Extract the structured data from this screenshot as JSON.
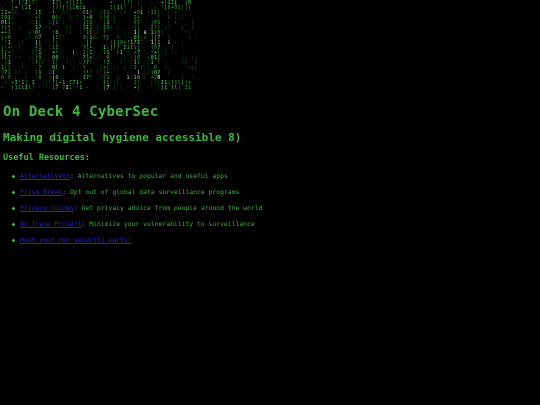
{
  "page": {
    "background_color": "#000000",
    "text_color": "#3fae3f",
    "link_color": "#1f27d6"
  },
  "banner": {
    "logo_text": "ODAC",
    "style": "matrix-rain"
  },
  "site_title": "On Deck 4 CyberSec",
  "tagline": "Making digital hygiene accessible 8)",
  "resources": {
    "heading": "Useful Resources:",
    "items": [
      {
        "link": "Alternativeto",
        "separator": ": ",
        "description": "Alternatives to popular and useful apps"
      },
      {
        "link": "Prism Break",
        "separator": ": ",
        "description": "Opt out of global data surveillance programs"
      },
      {
        "link": "Privacy Guides",
        "separator": ": ",
        "description": "Get privacy advice from people around the world"
      },
      {
        "link": "No Trace Project",
        "separator": ": ",
        "description": "Minimize your vulnerability to surveillance"
      },
      {
        "link": "Host your own security party!",
        "separator": "",
        "description": ""
      }
    ]
  }
}
